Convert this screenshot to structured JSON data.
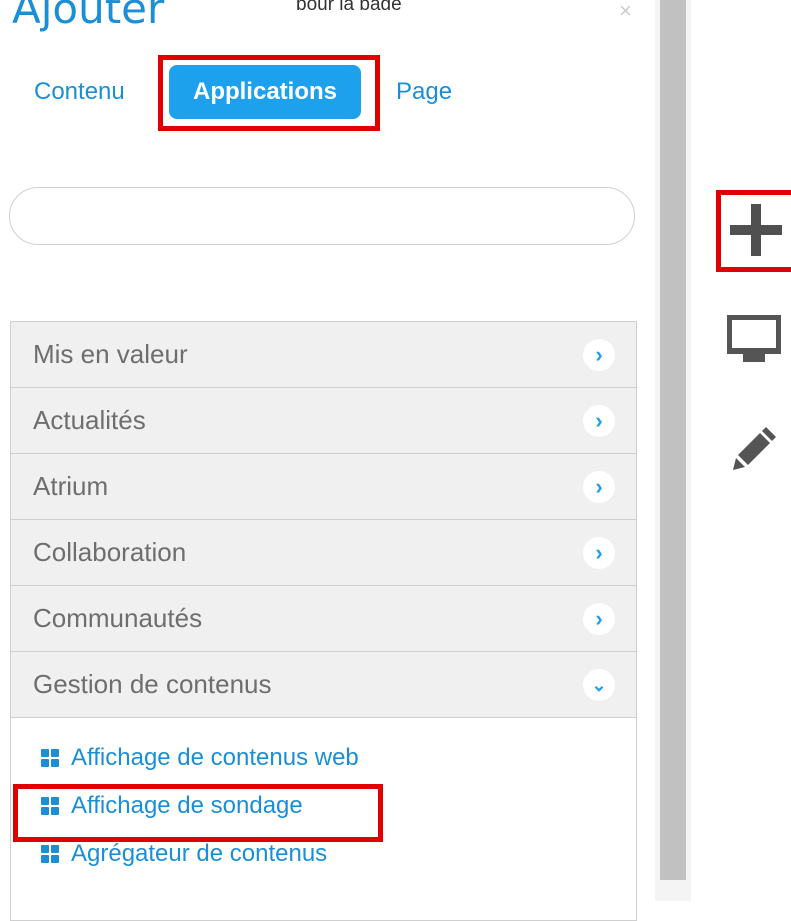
{
  "panel": {
    "title": "Ajouter",
    "top_fragment": "pour la page",
    "close_glyph": "×"
  },
  "tabs": [
    {
      "label": "Contenu",
      "active": false
    },
    {
      "label": "Applications",
      "active": true
    },
    {
      "label": "Page",
      "active": false
    }
  ],
  "search": {
    "value": "",
    "placeholder": ""
  },
  "categories": [
    {
      "label": "Mis en valeur",
      "expanded": false
    },
    {
      "label": "Actualités",
      "expanded": false
    },
    {
      "label": "Atrium",
      "expanded": false
    },
    {
      "label": "Collaboration",
      "expanded": false
    },
    {
      "label": "Communautés",
      "expanded": false
    },
    {
      "label": "Gestion de contenus",
      "expanded": true
    }
  ],
  "expanded_items": [
    {
      "label": "Affichage de contenus web"
    },
    {
      "label": "Affichage de sondage"
    },
    {
      "label": "Agrégateur de contenus"
    }
  ],
  "toolbar": {
    "add_icon": "plus-icon",
    "preview_icon": "monitor-icon",
    "edit_icon": "pencil-icon"
  },
  "colors": {
    "accent": "#1a8fd6",
    "active_tab_bg": "#1ea1ec",
    "highlight": "#e00000",
    "row_bg": "#f0f0f0",
    "row_text": "#6e6e6e",
    "icon_gray": "#505050"
  }
}
